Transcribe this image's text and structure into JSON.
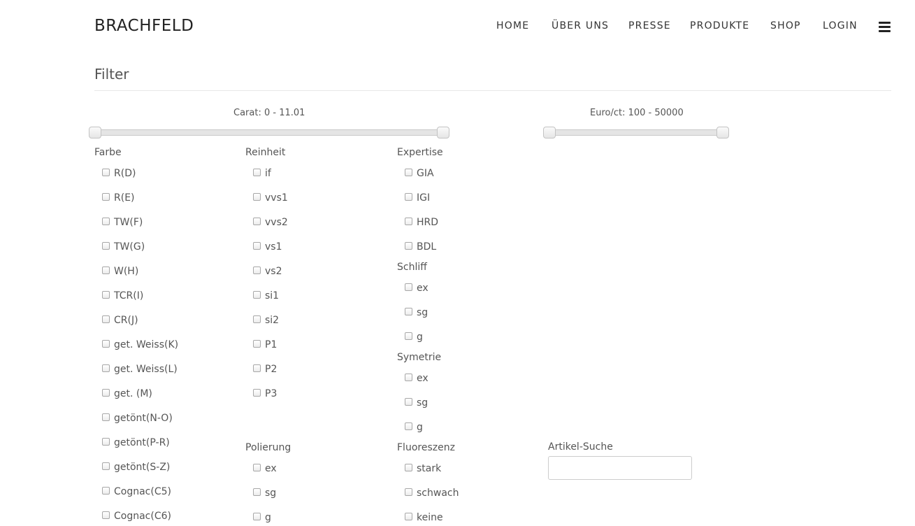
{
  "header": {
    "brand": "BRACHFELD",
    "nav": [
      "HOME",
      "ÜBER UNS",
      "PRESSE",
      "PRODUKTE",
      "SHOP",
      "LOGIN"
    ]
  },
  "filter": {
    "title": "Filter",
    "sliders": [
      {
        "label": "Carat: 0 - 11.01",
        "min": 0,
        "max": 11.01,
        "low": 0,
        "high": 11.01
      },
      {
        "label": "Euro/ct: 100 - 50000",
        "min": 100,
        "max": 50000,
        "low": 100,
        "high": 50000
      }
    ],
    "groups": {
      "farbe": {
        "title": "Farbe",
        "items": [
          "R(D)",
          "R(E)",
          "TW(F)",
          "TW(G)",
          "W(H)",
          "TCR(I)",
          "CR(J)",
          "get. Weiss(K)",
          "get. Weiss(L)",
          "get. (M)",
          "getönt(N-O)",
          "getönt(P-R)",
          "getönt(S-Z)",
          "Cognac(C5)",
          "Cognac(C6)"
        ]
      },
      "reinheit": {
        "title": "Reinheit",
        "items": [
          "if",
          "vvs1",
          "vvs2",
          "vs1",
          "vs2",
          "si1",
          "si2",
          "P1",
          "P2",
          "P3"
        ]
      },
      "polierung": {
        "title": "Polierung",
        "items": [
          "ex",
          "sg",
          "g"
        ]
      },
      "expertise": {
        "title": "Expertise",
        "items": [
          "GIA",
          "IGI",
          "HRD",
          "BDL"
        ]
      },
      "schliff": {
        "title": "Schliff",
        "items": [
          "ex",
          "sg",
          "g"
        ]
      },
      "symetrie": {
        "title": "Symetrie",
        "items": [
          "ex",
          "sg",
          "g"
        ]
      },
      "fluoreszenz": {
        "title": "Fluoreszenz",
        "items": [
          "stark",
          "schwach",
          "keine"
        ]
      }
    },
    "search": {
      "label": "Artikel-Suche",
      "value": "",
      "placeholder": ""
    }
  }
}
